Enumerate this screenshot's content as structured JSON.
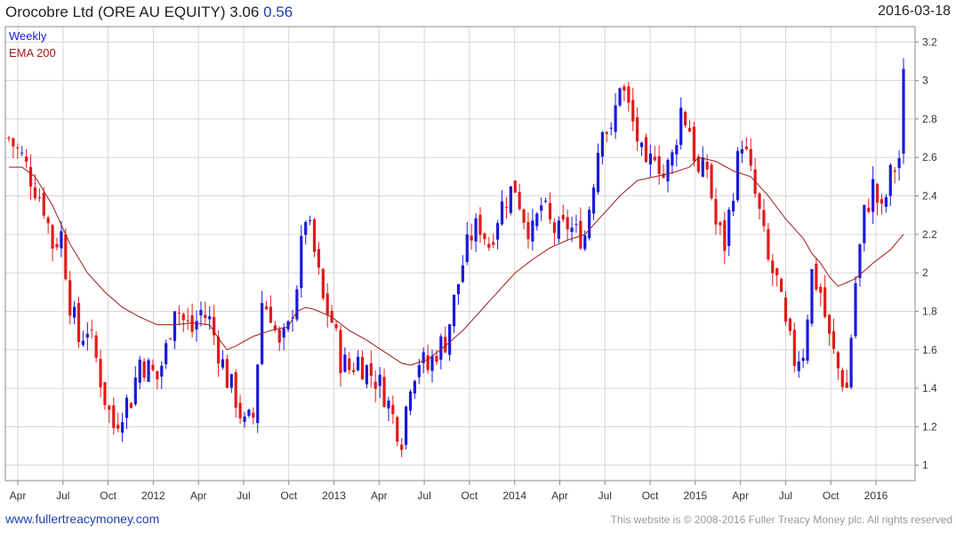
{
  "header": {
    "title": "Orocobre Ltd (ORE AU EQUITY)",
    "last": "3.06",
    "change": "0.56",
    "date": "2016-03-18"
  },
  "footer": {
    "site": "www.fullertreacymoney.com",
    "copyright": "This website is © 2008-2016 Fuller Treacy Money plc. All rights reserved"
  },
  "colors": {
    "up": "#1a1adb",
    "down": "#e01b1b",
    "ema": "#a01a1a",
    "grid": "#d6d6d6"
  },
  "chart_data": {
    "type": "candlestick",
    "interval_label": "Weekly",
    "legend": [
      {
        "name": "Weekly",
        "color": "#1a1adb"
      },
      {
        "name": "EMA 200",
        "color": "#a01a1a"
      }
    ],
    "legend_position": "top-left",
    "grid": true,
    "ylim": [
      0.92,
      3.28
    ],
    "y_ticks": [
      1,
      1.2,
      1.4,
      1.6,
      1.8,
      2,
      2.2,
      2.4,
      2.6,
      2.8,
      3,
      3.2
    ],
    "x_ticks": [
      "Apr",
      "Jul",
      "Oct",
      "2012",
      "Apr",
      "Jul",
      "Oct",
      "2013",
      "Apr",
      "Jul",
      "Oct",
      "2014",
      "Apr",
      "Jul",
      "Oct",
      "2015",
      "Apr",
      "Jul",
      "Oct",
      "2016"
    ],
    "candle_keypoints": [
      [
        0,
        2.7
      ],
      [
        3,
        2.6
      ],
      [
        6,
        2.45
      ],
      [
        8,
        2.35
      ],
      [
        10,
        2.15
      ],
      [
        12,
        2.2
      ],
      [
        14,
        1.85
      ],
      [
        16,
        1.65
      ],
      [
        18,
        1.72
      ],
      [
        20,
        1.55
      ],
      [
        22,
        1.35
      ],
      [
        24,
        1.2
      ],
      [
        26,
        1.3
      ],
      [
        28,
        1.35
      ],
      [
        30,
        1.55
      ],
      [
        32,
        1.5
      ],
      [
        34,
        1.45
      ],
      [
        36,
        1.6
      ],
      [
        38,
        1.85
      ],
      [
        40,
        1.75
      ],
      [
        42,
        1.7
      ],
      [
        44,
        1.8
      ],
      [
        46,
        1.75
      ],
      [
        48,
        1.6
      ],
      [
        50,
        1.45
      ],
      [
        52,
        1.35
      ],
      [
        54,
        1.2
      ],
      [
        56,
        1.25
      ],
      [
        58,
        1.85
      ],
      [
        60,
        1.8
      ],
      [
        62,
        1.6
      ],
      [
        64,
        1.7
      ],
      [
        66,
        1.95
      ],
      [
        68,
        2.3
      ],
      [
        70,
        2.1
      ],
      [
        72,
        1.85
      ],
      [
        74,
        1.75
      ],
      [
        76,
        1.55
      ],
      [
        78,
        1.5
      ],
      [
        80,
        1.55
      ],
      [
        82,
        1.5
      ],
      [
        84,
        1.45
      ],
      [
        86,
        1.38
      ],
      [
        88,
        1.25
      ],
      [
        90,
        1.15
      ],
      [
        92,
        1.45
      ],
      [
        94,
        1.55
      ],
      [
        96,
        1.5
      ],
      [
        98,
        1.6
      ],
      [
        100,
        1.65
      ],
      [
        102,
        1.85
      ],
      [
        104,
        2.05
      ],
      [
        106,
        2.2
      ],
      [
        108,
        2.25
      ],
      [
        110,
        2.15
      ],
      [
        112,
        2.3
      ],
      [
        114,
        2.4
      ],
      [
        116,
        2.45
      ],
      [
        118,
        2.3
      ],
      [
        120,
        2.2
      ],
      [
        122,
        2.35
      ],
      [
        124,
        2.25
      ],
      [
        126,
        2.2
      ],
      [
        128,
        2.25
      ],
      [
        130,
        2.2
      ],
      [
        132,
        2.2
      ],
      [
        134,
        2.5
      ],
      [
        136,
        2.8
      ],
      [
        138,
        2.7
      ],
      [
        140,
        3.0
      ],
      [
        142,
        2.85
      ],
      [
        144,
        2.7
      ],
      [
        146,
        2.5
      ],
      [
        148,
        2.65
      ],
      [
        150,
        2.5
      ],
      [
        152,
        2.6
      ],
      [
        154,
        2.85
      ],
      [
        156,
        2.75
      ],
      [
        158,
        2.5
      ],
      [
        160,
        2.55
      ],
      [
        162,
        2.25
      ],
      [
        164,
        2.15
      ],
      [
        166,
        2.45
      ],
      [
        168,
        2.7
      ],
      [
        170,
        2.5
      ],
      [
        172,
        2.3
      ],
      [
        174,
        2.05
      ],
      [
        176,
        1.95
      ],
      [
        178,
        1.7
      ],
      [
        180,
        1.55
      ],
      [
        182,
        1.6
      ],
      [
        184,
        2.0
      ],
      [
        186,
        1.9
      ],
      [
        188,
        1.65
      ],
      [
        190,
        1.5
      ],
      [
        192,
        1.4
      ],
      [
        194,
        1.95
      ],
      [
        196,
        2.3
      ],
      [
        198,
        2.45
      ],
      [
        200,
        2.3
      ],
      [
        202,
        2.5
      ],
      [
        204,
        2.6
      ],
      [
        205,
        3.05
      ]
    ],
    "ema200_keypoints": [
      [
        0,
        2.55
      ],
      [
        3,
        2.55
      ],
      [
        6,
        2.5
      ],
      [
        10,
        2.35
      ],
      [
        14,
        2.15
      ],
      [
        18,
        2.0
      ],
      [
        22,
        1.9
      ],
      [
        26,
        1.82
      ],
      [
        30,
        1.77
      ],
      [
        34,
        1.73
      ],
      [
        38,
        1.73
      ],
      [
        42,
        1.74
      ],
      [
        46,
        1.73
      ],
      [
        48,
        1.66
      ],
      [
        50,
        1.6
      ],
      [
        52,
        1.62
      ],
      [
        56,
        1.67
      ],
      [
        60,
        1.7
      ],
      [
        64,
        1.72
      ],
      [
        66,
        1.8
      ],
      [
        68,
        1.82
      ],
      [
        70,
        1.81
      ],
      [
        74,
        1.77
      ],
      [
        78,
        1.7
      ],
      [
        82,
        1.65
      ],
      [
        86,
        1.59
      ],
      [
        90,
        1.53
      ],
      [
        92,
        1.52
      ],
      [
        96,
        1.55
      ],
      [
        100,
        1.62
      ],
      [
        104,
        1.7
      ],
      [
        108,
        1.8
      ],
      [
        112,
        1.9
      ],
      [
        116,
        2.0
      ],
      [
        120,
        2.07
      ],
      [
        124,
        2.13
      ],
      [
        128,
        2.17
      ],
      [
        132,
        2.2
      ],
      [
        136,
        2.3
      ],
      [
        140,
        2.4
      ],
      [
        144,
        2.48
      ],
      [
        148,
        2.5
      ],
      [
        152,
        2.52
      ],
      [
        156,
        2.55
      ],
      [
        158,
        2.6
      ],
      [
        162,
        2.58
      ],
      [
        166,
        2.53
      ],
      [
        170,
        2.5
      ],
      [
        174,
        2.4
      ],
      [
        178,
        2.28
      ],
      [
        182,
        2.18
      ],
      [
        184,
        2.1
      ],
      [
        186,
        2.05
      ],
      [
        188,
        1.98
      ],
      [
        190,
        1.93
      ],
      [
        194,
        1.97
      ],
      [
        198,
        2.05
      ],
      [
        202,
        2.12
      ],
      [
        205,
        2.2
      ]
    ]
  }
}
